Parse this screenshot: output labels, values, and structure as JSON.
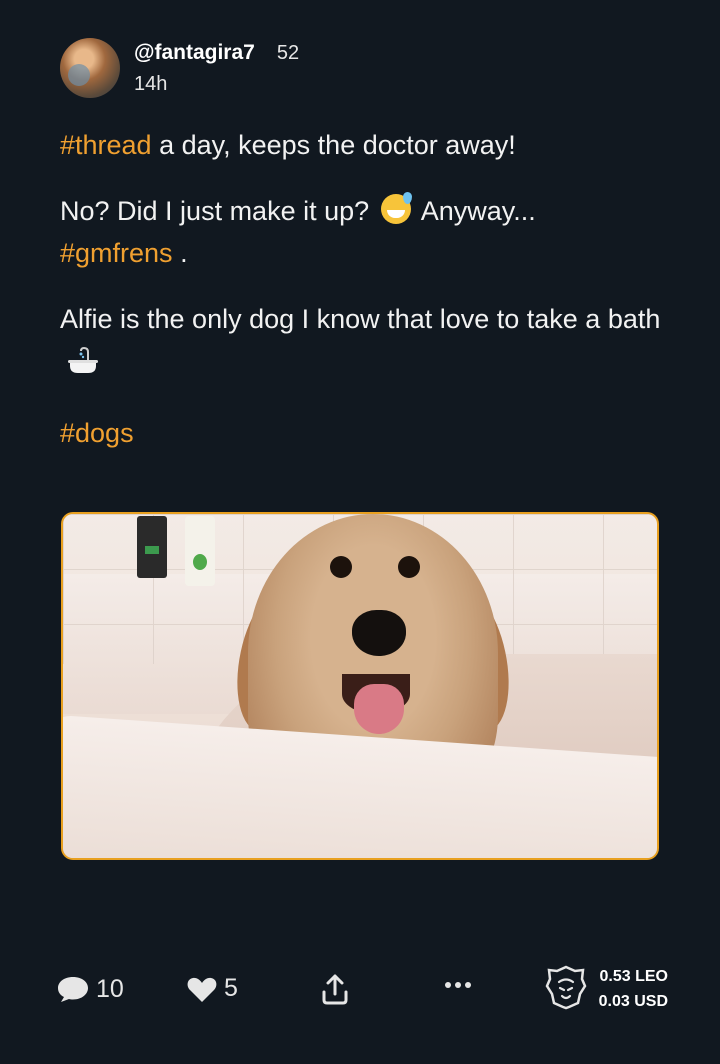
{
  "post": {
    "author": {
      "username": "@fantagira7",
      "reputation": "52",
      "timestamp": "14h"
    },
    "paragraphs": {
      "p1_tag": "#thread",
      "p1_text": " a day, keeps the doctor away!",
      "p2_text_a": "No? Did I just make it up?",
      "p2_text_b": "Anyway...",
      "p2_tag": "#gmfrens",
      "p2_tail": " .",
      "p3_text": "Alfie is the only dog I know that love to take a bath",
      "p4_tag": "#dogs"
    },
    "image": {
      "subject": "dog-in-bathtub"
    },
    "actions": {
      "comments": "10",
      "likes": "5"
    },
    "earnings": {
      "leo": "0.53 LEO",
      "usd": "0.03 USD"
    }
  },
  "colors": {
    "background": "#111820",
    "hashtag": "#f0a030",
    "image_border": "#e8a020"
  }
}
